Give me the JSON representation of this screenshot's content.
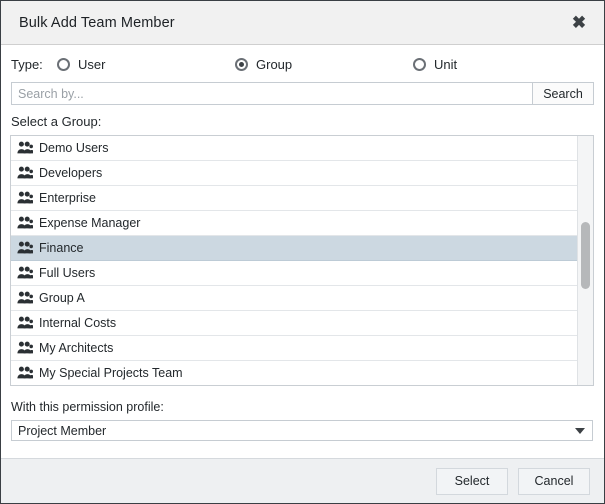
{
  "dialog": {
    "title": "Bulk Add Team Member",
    "close_icon": "close-icon"
  },
  "type_section": {
    "label": "Type:",
    "options": [
      {
        "label": "User",
        "selected": false
      },
      {
        "label": "Group",
        "selected": true
      },
      {
        "label": "Unit",
        "selected": false
      }
    ]
  },
  "search": {
    "placeholder": "Search by...",
    "value": "",
    "button_label": "Search"
  },
  "list_section": {
    "label": "Select a Group:",
    "item_icon": "group-icon",
    "items": [
      {
        "label": "Demo Users",
        "selected": false
      },
      {
        "label": "Developers",
        "selected": false
      },
      {
        "label": "Enterprise",
        "selected": false
      },
      {
        "label": "Expense Manager",
        "selected": false
      },
      {
        "label": "Finance",
        "selected": true
      },
      {
        "label": "Full Users",
        "selected": false
      },
      {
        "label": "Group A",
        "selected": false
      },
      {
        "label": "Internal Costs",
        "selected": false
      },
      {
        "label": "My Architects",
        "selected": false
      },
      {
        "label": "My Special Projects Team",
        "selected": false
      }
    ],
    "scrollbar": "vertical-scrollbar"
  },
  "profile_section": {
    "label": "With this permission profile:",
    "value": "Project Member",
    "arrow_icon": "chevron-down-icon"
  },
  "footer": {
    "select_label": "Select",
    "cancel_label": "Cancel"
  },
  "colors": {
    "selected_row": "#ccd8e1",
    "titlebar": "#f1f1f1",
    "footer": "#eef0f2",
    "border": "#3a3f44"
  }
}
